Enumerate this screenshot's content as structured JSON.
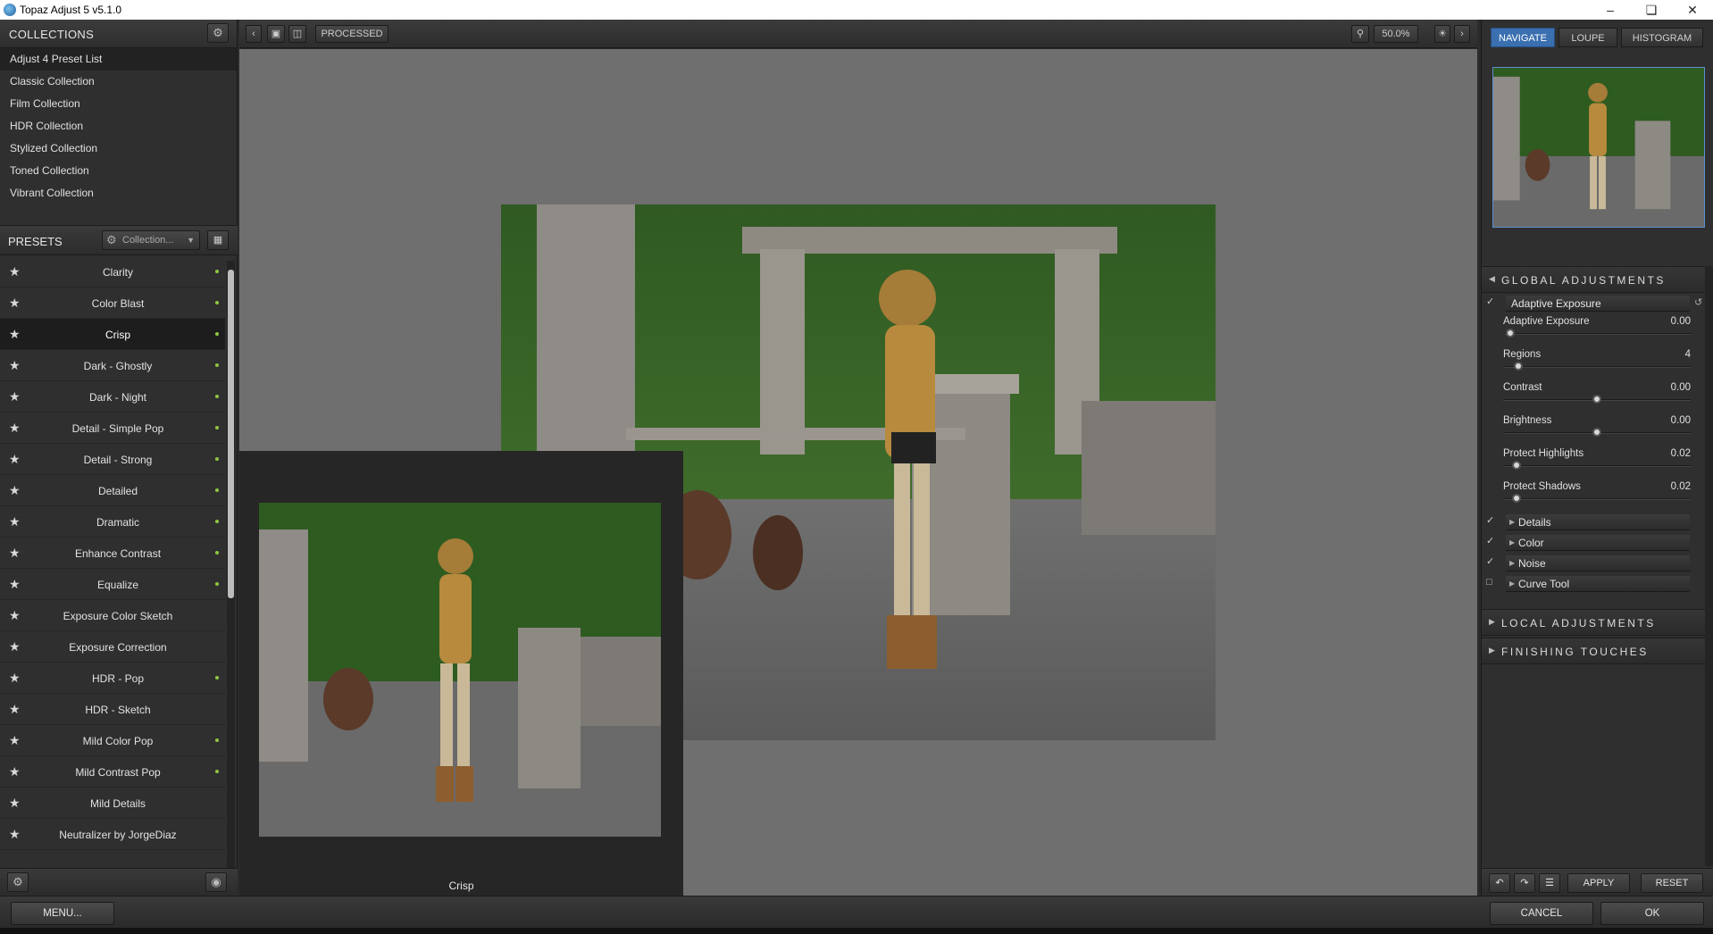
{
  "window": {
    "title": "Topaz Adjust 5 v5.1.0"
  },
  "collections": {
    "heading": "COLLECTIONS",
    "items": [
      "Adjust 4 Preset List",
      "Classic Collection",
      "Film Collection",
      "HDR Collection",
      "Stylized Collection",
      "Toned Collection",
      "Vibrant Collection"
    ],
    "selected": "Adjust 4 Preset List"
  },
  "presets": {
    "heading": "PRESETS",
    "collection_select": "Collection...",
    "items": [
      {
        "name": "Clarity",
        "dot": true
      },
      {
        "name": "Color Blast",
        "dot": true
      },
      {
        "name": "Crisp",
        "dot": true,
        "selected": true
      },
      {
        "name": "Dark - Ghostly",
        "dot": true
      },
      {
        "name": "Dark - Night",
        "dot": true
      },
      {
        "name": "Detail - Simple Pop",
        "dot": true
      },
      {
        "name": "Detail - Strong",
        "dot": true
      },
      {
        "name": "Detailed",
        "dot": true
      },
      {
        "name": "Dramatic",
        "dot": true
      },
      {
        "name": "Enhance Contrast",
        "dot": true
      },
      {
        "name": "Equalize",
        "dot": true
      },
      {
        "name": "Exposure Color Sketch",
        "dot": false
      },
      {
        "name": "Exposure Correction",
        "dot": false
      },
      {
        "name": "HDR - Pop",
        "dot": true
      },
      {
        "name": "HDR - Sketch",
        "dot": false
      },
      {
        "name": "Mild Color Pop",
        "dot": true
      },
      {
        "name": "Mild Contrast Pop",
        "dot": true
      },
      {
        "name": "Mild Details",
        "dot": false
      },
      {
        "name": "Neutralizer by JorgeDiaz",
        "dot": false
      }
    ]
  },
  "toolbar": {
    "view_label": "PROCESSED",
    "zoom": "50.0%"
  },
  "preview": {
    "caption": "Crisp"
  },
  "right_tabs": {
    "navigate": "NAVIGATE",
    "loupe": "LOUPE",
    "histogram": "HISTOGRAM",
    "active": "NAVIGATE"
  },
  "adjustments": {
    "global_label": "GLOBAL ADJUSTMENTS",
    "adaptive_header": "Adaptive Exposure",
    "sliders": [
      {
        "label": "Adaptive Exposure",
        "value": "0.00",
        "level": 0.04
      },
      {
        "label": "Regions",
        "value": "4",
        "level": 0.08
      },
      {
        "label": "Contrast",
        "value": "0.00",
        "level": 0.5
      },
      {
        "label": "Brightness",
        "value": "0.00",
        "level": 0.5
      },
      {
        "label": "Protect Highlights",
        "value": "0.02",
        "level": 0.07
      },
      {
        "label": "Protect Shadows",
        "value": "0.02",
        "level": 0.07
      }
    ],
    "subsections": [
      {
        "label": "Details",
        "checked": true
      },
      {
        "label": "Color",
        "checked": true
      },
      {
        "label": "Noise",
        "checked": true
      },
      {
        "label": "Curve Tool",
        "checked": false
      }
    ],
    "local_label": "LOCAL ADJUSTMENTS",
    "finishing_label": "FINISHING TOUCHES"
  },
  "actions": {
    "apply": "APPLY",
    "reset": "RESET",
    "menu": "MENU...",
    "cancel": "CANCEL",
    "ok": "OK"
  },
  "colors": {
    "accent": "#3a6fb0",
    "preset_dot": "#8ec63f"
  }
}
